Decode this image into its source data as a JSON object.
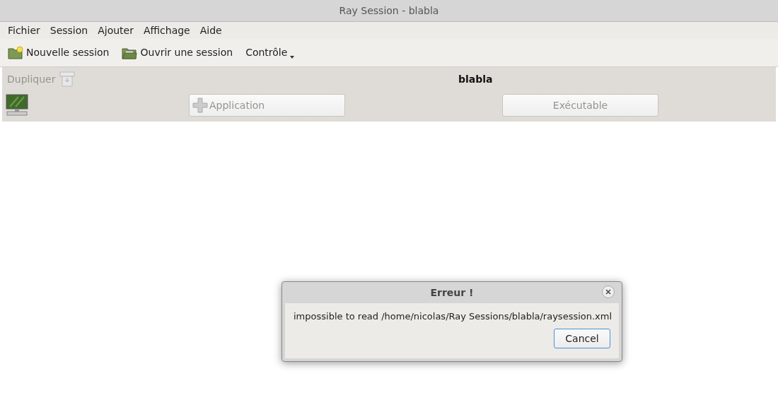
{
  "window": {
    "title": "Ray Session - blabla"
  },
  "menu": [
    "Fichier",
    "Session",
    "Ajouter",
    "Affichage",
    "Aide"
  ],
  "toolbar": [
    {
      "kind": "new",
      "label": "Nouvelle session"
    },
    {
      "kind": "open",
      "label": "Ouvrir une session"
    },
    {
      "kind": "menu",
      "label": "Contrôle"
    }
  ],
  "session_bar": {
    "duplicate": {
      "label": "Dupliquer",
      "disabled": true
    },
    "name": "blabla",
    "add_application": {
      "label": "Application",
      "disabled": true
    },
    "executable": {
      "label": "Exécutable",
      "disabled": true
    }
  },
  "dialog": {
    "title": "Erreur !",
    "message": "impossible to read /home/nicolas/Ray Sessions/blabla/raysession.xml",
    "button": "Cancel"
  }
}
